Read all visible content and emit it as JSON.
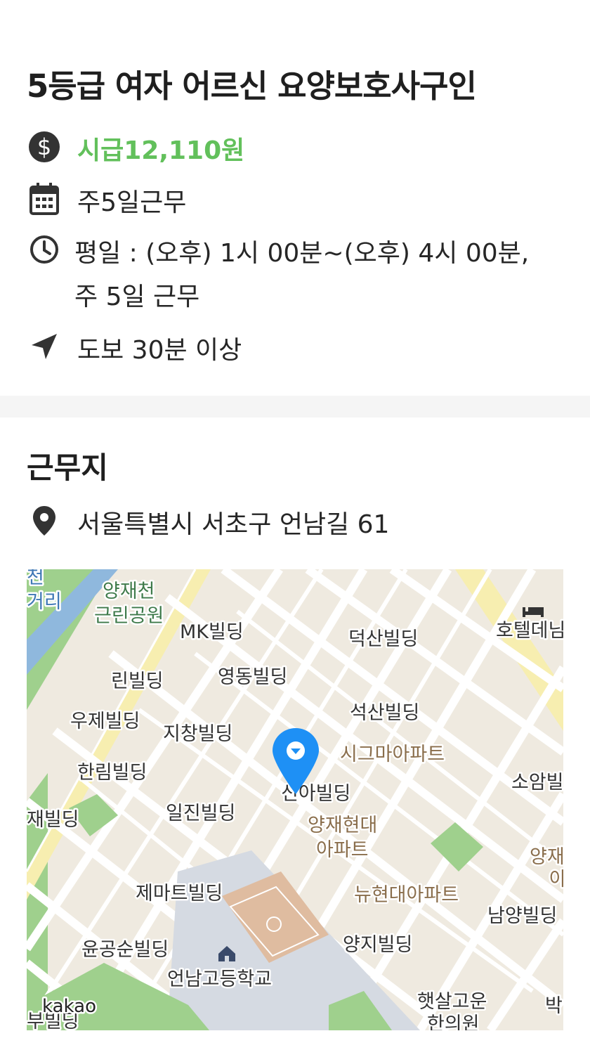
{
  "job": {
    "title": "5등급 여자 어르신 요양보호사구인",
    "wage": "시급12,110원",
    "days": "주5일근무",
    "schedule_line1": "평일 : (오후) 1시 00분~(오후) 4시 00분,",
    "schedule_line2": "주 5일 근무",
    "distance": "도보 30분 이상"
  },
  "workplace": {
    "title": "근무지",
    "address": "서울특별시 서초구 언남길 61"
  },
  "map": {
    "labels": {
      "yangjaecheon": "양재천",
      "park": "근린공원",
      "cheon": "천",
      "geori": "거리",
      "mk": "MK빌딩",
      "deoksan": "덕산빌딩",
      "hotel": "호텔데님",
      "rin": "린빌딩",
      "yeongdong": "영동빌딩",
      "woojae": "우제빌딩",
      "jichang": "지창빌딩",
      "seoksan": "석산빌딩",
      "sigma": "시그마아파트",
      "hanrim": "한림빌딩",
      "sinah": "신아빌딩",
      "soam": "소암빌",
      "jae": "재빌딩",
      "iljin": "일진빌딩",
      "yangjae_hd1": "양재현대",
      "yangjae_hd2": "아파트",
      "yang": "양재",
      "a": "아",
      "jemart": "제마트빌딩",
      "newhd": "뉴현대아파트",
      "namyang": "남양빌딩",
      "yungongsun": "윤공순빌딩",
      "yangji": "양지빌딩",
      "eonnam": "언남고등학교",
      "haetsal1": "햇살고운",
      "haetsal2": "한의원",
      "bu": "부빌딩",
      "bak": "박",
      "kakao": "kakao"
    },
    "colors": {
      "land": "#efeae0",
      "road": "#ffffff",
      "park": "#9fd08d",
      "water": "#8fb8dd",
      "pin": "#1e90f5",
      "arterial": "#f7eeb0"
    }
  },
  "icons": [
    "dollar-icon",
    "calendar-icon",
    "clock-icon",
    "navigation-arrow-icon",
    "location-pin-icon",
    "map-marker-icon",
    "school-icon",
    "hotel-icon"
  ]
}
